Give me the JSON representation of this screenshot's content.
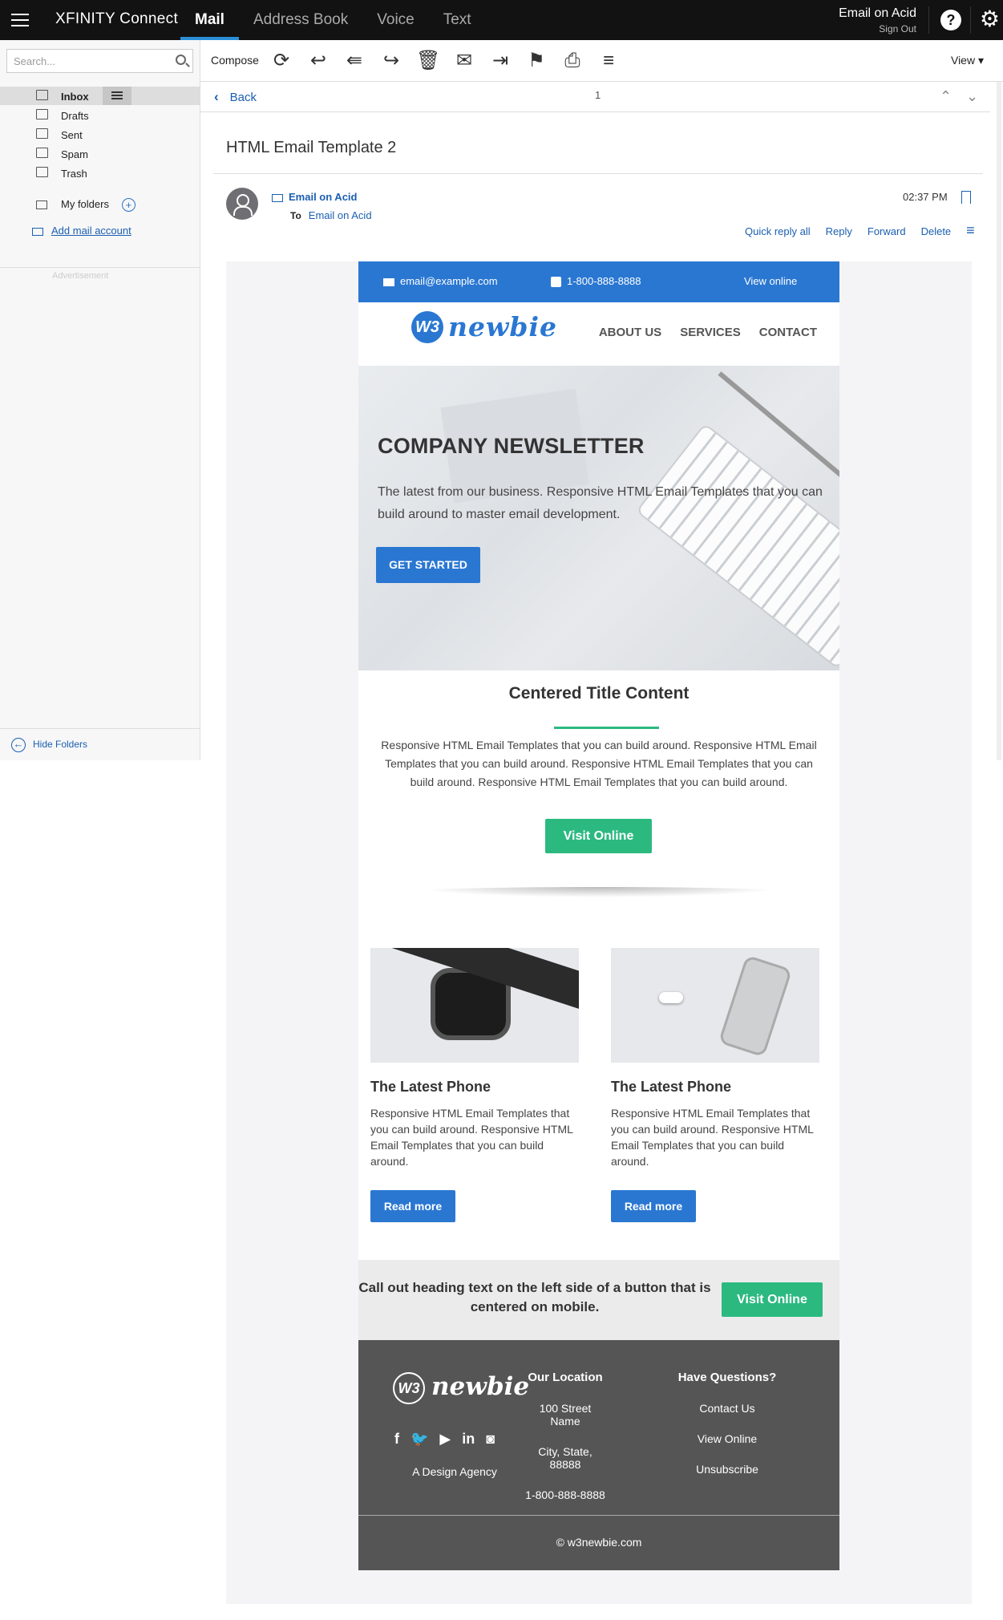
{
  "topbar": {
    "brand": "XFINITY Connect",
    "tabs": [
      {
        "label": "Mail",
        "active": true
      },
      {
        "label": "Address Book"
      },
      {
        "label": "Voice"
      },
      {
        "label": "Text"
      }
    ],
    "user_name": "Email on Acid",
    "sign_out": "Sign Out"
  },
  "sidebar": {
    "search_placeholder": "Search...",
    "folders": [
      {
        "label": "Inbox",
        "icon": "inbox-icon"
      },
      {
        "label": "Drafts",
        "icon": "drafts-icon"
      },
      {
        "label": "Sent",
        "icon": "sent-icon"
      },
      {
        "label": "Spam",
        "icon": "spam-icon"
      },
      {
        "label": "Trash",
        "icon": "trash-icon"
      }
    ],
    "my_folders": "My folders",
    "add_mail_account": "Add mail account",
    "advertisement": "Advertisement",
    "hide_folders": "Hide Folders"
  },
  "toolbar": {
    "compose": "Compose",
    "view": "View"
  },
  "navrow": {
    "back": "Back",
    "page": "1"
  },
  "message": {
    "subject": "HTML Email Template 2",
    "from": "Email on Acid",
    "to_label": "To",
    "to": "Email on Acid",
    "time": "02:37 PM",
    "actions": [
      "Quick reply all",
      "Reply",
      "Forward",
      "Delete"
    ]
  },
  "email": {
    "header": {
      "email": "email@example.com",
      "phone": "1-800-888-8888",
      "view_online": "View online"
    },
    "logo_w3": "W3",
    "logo_name": "newbie",
    "menu": [
      "ABOUT US",
      "SERVICES",
      "CONTACT"
    ],
    "hero": {
      "title": "COMPANY NEWSLETTER",
      "text": "The latest from our business. Responsive HTML Email Templates that you can build around to master email development.",
      "button": "GET STARTED"
    },
    "centered": {
      "title": "Centered Title Content",
      "text": "Responsive HTML Email Templates that you can build around. Responsive HTML Email Templates that you can build around. Responsive HTML Email Templates that you can build around. Responsive HTML Email Templates that you can build around.",
      "button": "Visit Online"
    },
    "cards": [
      {
        "title": "The Latest Phone",
        "text": "Responsive HTML Email Templates that you can build around. Responsive HTML Email Templates that you can build around.",
        "button": "Read more"
      },
      {
        "title": "The Latest Phone",
        "text": "Responsive HTML Email Templates that you can build around. Responsive HTML Email Templates that you can build around.",
        "button": "Read more"
      }
    ],
    "callout": {
      "text": "Call out heading text on the left side of a button that is centered on mobile.",
      "button": "Visit Online"
    },
    "footer": {
      "agency": "A Design Agency",
      "social": [
        "f",
        "t",
        "yt",
        "in",
        "ig"
      ],
      "location_heading": "Our Location",
      "location": [
        "100 Street Name",
        "City, State, 88888",
        "1-800-888-8888"
      ],
      "questions_heading": "Have Questions?",
      "questions": [
        "Contact Us",
        "View Online",
        "Unsubscribe"
      ],
      "copyright": "© w3newbie.com"
    }
  }
}
